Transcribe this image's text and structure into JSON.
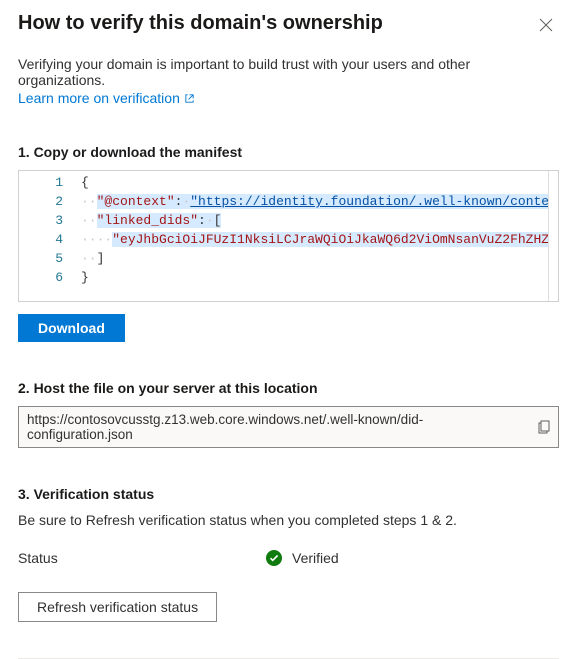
{
  "header": {
    "title": "How to verify this domain's ownership"
  },
  "intro": {
    "text": "Verifying your domain is important to build trust with your users and other organizations.",
    "learn_more": "Learn more on verification"
  },
  "step1": {
    "heading": "1. Copy or download the manifest",
    "download_label": "Download",
    "code_lines": [
      {
        "n": "1",
        "seg": [
          {
            "cls": "tok-brace",
            "t": "{"
          }
        ]
      },
      {
        "n": "2",
        "seg": [
          {
            "cls": "tok-dots",
            "t": "··"
          },
          {
            "cls": "tok-key hl",
            "t": "\"@context\""
          },
          {
            "cls": "tok-punct hl",
            "t": ":"
          },
          {
            "cls": "tok-dots hl",
            "t": "·"
          },
          {
            "cls": "tok-str-link hl",
            "t": "\"https://identity.foundation/.well-known/conte"
          }
        ]
      },
      {
        "n": "3",
        "seg": [
          {
            "cls": "tok-dots",
            "t": "··"
          },
          {
            "cls": "tok-key hl",
            "t": "\"linked_dids\""
          },
          {
            "cls": "tok-punct hl",
            "t": ":"
          },
          {
            "cls": "tok-dots hl",
            "t": "·"
          },
          {
            "cls": "tok-brace hl",
            "t": "["
          }
        ]
      },
      {
        "n": "4",
        "seg": [
          {
            "cls": "tok-dots",
            "t": "····"
          },
          {
            "cls": "tok-key hl",
            "t": "\"eyJhbGciOiJFUzI1NksiLCJraWQiOiJkaWQ6d2ViOmNsanVuZ2FhZHZ"
          }
        ]
      },
      {
        "n": "5",
        "seg": [
          {
            "cls": "tok-dots",
            "t": "··"
          },
          {
            "cls": "tok-brace",
            "t": "]"
          }
        ]
      },
      {
        "n": "6",
        "seg": [
          {
            "cls": "tok-brace",
            "t": "}"
          }
        ]
      }
    ]
  },
  "step2": {
    "heading": "2. Host the file on your server at this location",
    "url": "https://contosovcusstg.z13.web.core.windows.net/.well-known/did-configuration.json"
  },
  "step3": {
    "heading": "3. Verification status",
    "note": "Be sure to Refresh verification status when you completed steps 1 & 2.",
    "status_label": "Status",
    "status_value": "Verified",
    "refresh_label": "Refresh verification status"
  }
}
